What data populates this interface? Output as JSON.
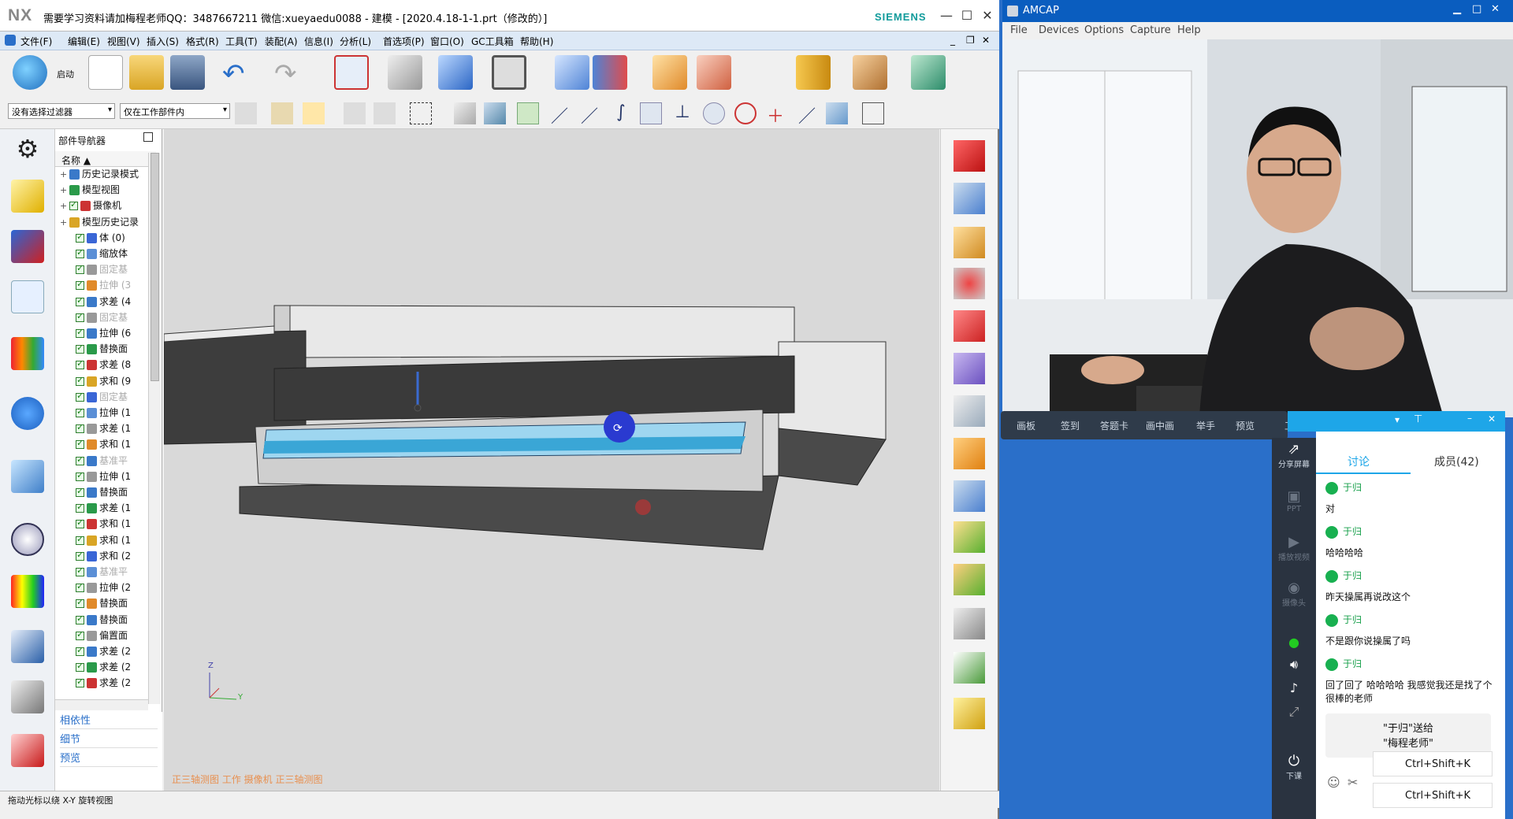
{
  "nx": {
    "logo": "NX",
    "title": "需要学习资料请加梅程老师QQ：3487667211 微信:xueyaedu0088 - 建模 - [2020.4.18-1-1.prt（修改的）]",
    "brand": "SIEMENS",
    "menu": [
      "文件(F)",
      "编辑(E)",
      "视图(V)",
      "插入(S)",
      "格式(R)",
      "工具(T)",
      "装配(A)",
      "信息(I)",
      "分析(L)",
      "首选项(P)",
      "窗口(O)",
      "GC工具箱",
      "帮助(H)"
    ],
    "start_label": "启动",
    "filter_select": "没有选择过滤器",
    "scope_select": "仅在工作部件内",
    "navigator": {
      "title": "部件导航器",
      "column": "名称",
      "items": [
        {
          "label": "历史记录模式",
          "indent": 1,
          "dim": false,
          "check": false
        },
        {
          "label": "模型视图",
          "indent": 1,
          "dim": false,
          "check": false
        },
        {
          "label": "摄像机",
          "indent": 1,
          "dim": false,
          "check": true
        },
        {
          "label": "模型历史记录",
          "indent": 1,
          "dim": false,
          "check": false
        },
        {
          "label": "体 (0)",
          "indent": 2,
          "dim": false,
          "check": true
        },
        {
          "label": "缩放体",
          "indent": 2,
          "dim": false,
          "check": true
        },
        {
          "label": "固定基",
          "indent": 2,
          "dim": true,
          "check": true
        },
        {
          "label": "拉伸 (3",
          "indent": 2,
          "dim": true,
          "check": true
        },
        {
          "label": "求差 (4",
          "indent": 2,
          "dim": false,
          "check": true
        },
        {
          "label": "固定基",
          "indent": 2,
          "dim": true,
          "check": true
        },
        {
          "label": "拉伸 (6",
          "indent": 2,
          "dim": false,
          "check": true
        },
        {
          "label": "替换面",
          "indent": 2,
          "dim": false,
          "check": true
        },
        {
          "label": "求差 (8",
          "indent": 2,
          "dim": false,
          "check": true
        },
        {
          "label": "求和 (9",
          "indent": 2,
          "dim": false,
          "check": true
        },
        {
          "label": "固定基",
          "indent": 2,
          "dim": true,
          "check": true
        },
        {
          "label": "拉伸 (1",
          "indent": 2,
          "dim": false,
          "check": true
        },
        {
          "label": "求差 (1",
          "indent": 2,
          "dim": false,
          "check": true
        },
        {
          "label": "求和 (1",
          "indent": 2,
          "dim": false,
          "check": true
        },
        {
          "label": "基准平",
          "indent": 2,
          "dim": true,
          "check": true
        },
        {
          "label": "拉伸 (1",
          "indent": 2,
          "dim": false,
          "check": true
        },
        {
          "label": "替换面",
          "indent": 2,
          "dim": false,
          "check": true
        },
        {
          "label": "求差 (1",
          "indent": 2,
          "dim": false,
          "check": true
        },
        {
          "label": "求和 (1",
          "indent": 2,
          "dim": false,
          "check": true
        },
        {
          "label": "求和 (1",
          "indent": 2,
          "dim": false,
          "check": true
        },
        {
          "label": "求和 (2",
          "indent": 2,
          "dim": false,
          "check": true
        },
        {
          "label": "基准平",
          "indent": 2,
          "dim": true,
          "check": true
        },
        {
          "label": "拉伸 (2",
          "indent": 2,
          "dim": false,
          "check": true
        },
        {
          "label": "替换面",
          "indent": 2,
          "dim": false,
          "check": true
        },
        {
          "label": "替换面",
          "indent": 2,
          "dim": false,
          "check": true
        },
        {
          "label": "偏置面",
          "indent": 2,
          "dim": false,
          "check": true
        },
        {
          "label": "求差 (2",
          "indent": 2,
          "dim": false,
          "check": true
        },
        {
          "label": "求差 (2",
          "indent": 2,
          "dim": false,
          "check": true
        },
        {
          "label": "求差 (2",
          "indent": 2,
          "dim": false,
          "check": true
        }
      ],
      "bottom": [
        "相依性",
        "细节",
        "预览"
      ]
    },
    "view_caption": "正三轴测图 工作 摄像机 正三轴测图",
    "status": "拖动光标以绕 X-Y 旋转视图",
    "axis": {
      "z": "Z",
      "y": "Y"
    }
  },
  "amcap": {
    "title": "AMCAP",
    "menu": [
      "File",
      "Devices",
      "Options",
      "Capture",
      "Help"
    ]
  },
  "classroom": {
    "toolbar": [
      "画板",
      "签到",
      "答题卡",
      "画中画",
      "举手",
      "预览",
      "工具"
    ],
    "side": [
      "分享屏幕",
      "PPT",
      "播放视频",
      "摄像头",
      "下课"
    ],
    "tabs": [
      "讨论",
      "成员(42)"
    ],
    "messages": [
      {
        "user": "于归",
        "text": "对"
      },
      {
        "user": "于归",
        "text": "哈哈哈哈"
      },
      {
        "user": "于归",
        "text": "昨天操属再说改这个"
      },
      {
        "user": "于归",
        "text": "不是跟你说操属了吗"
      },
      {
        "user": "于归",
        "text": "回了回了 哈哈哈哈 我感觉我还是找了个很棒的老师"
      }
    ],
    "gift": [
      "\"于归\"送给",
      "\"梅程老师\""
    ],
    "hotkeys": [
      "Ctrl+Shift+K",
      "Ctrl+Shift+K"
    ]
  }
}
